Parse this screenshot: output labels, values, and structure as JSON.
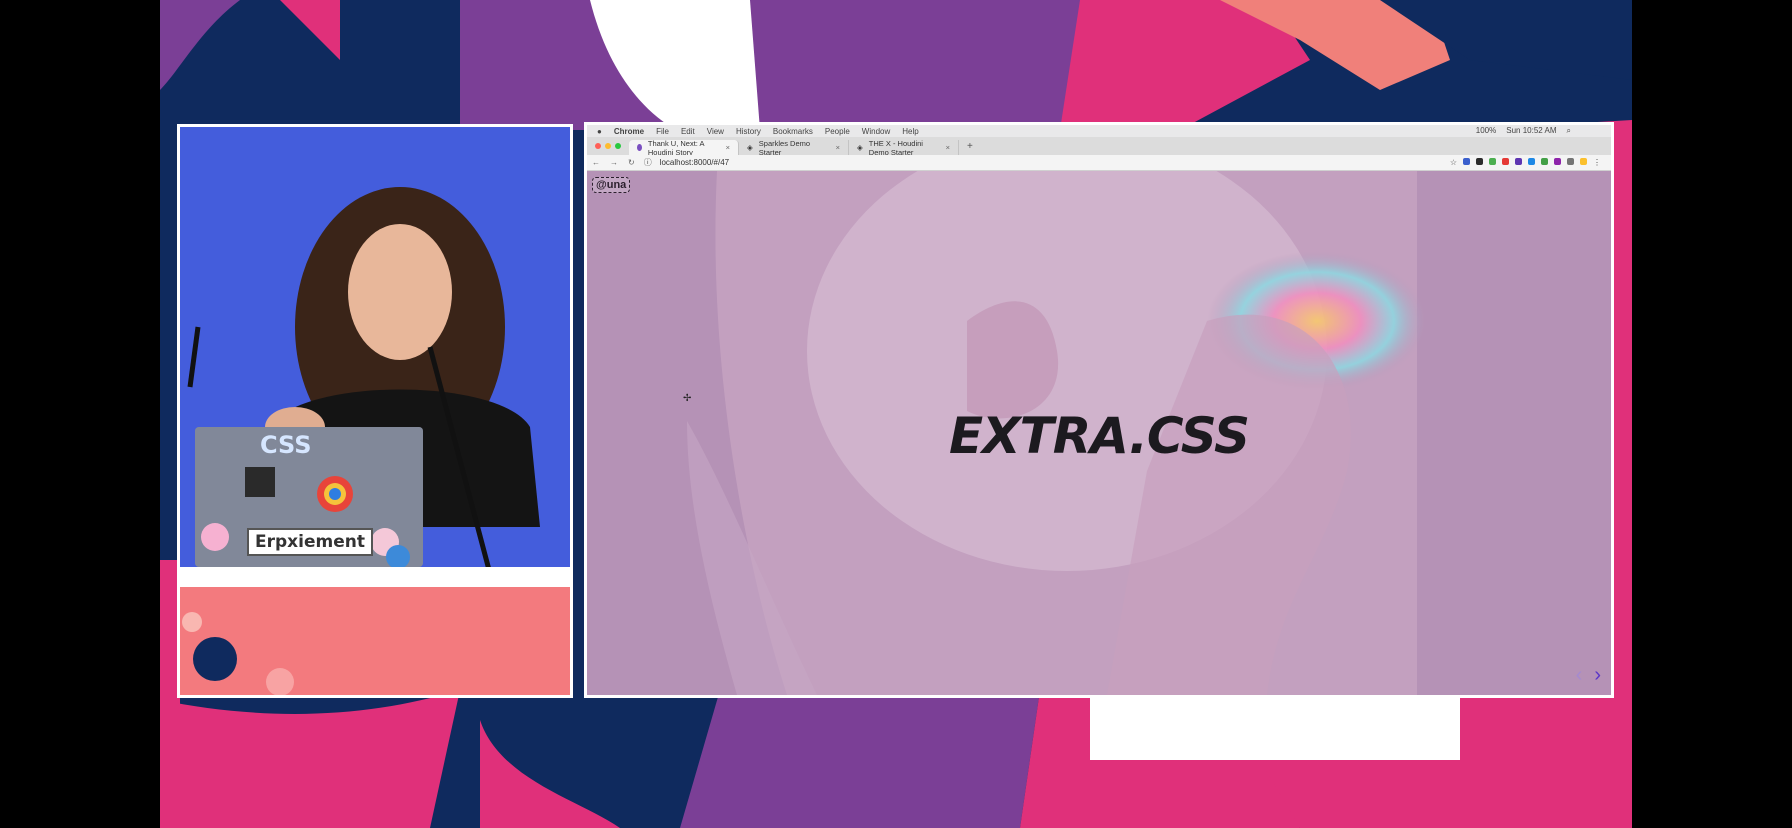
{
  "browser": {
    "menu": [
      "Chrome",
      "File",
      "Edit",
      "View",
      "History",
      "Bookmarks",
      "People",
      "Window",
      "Help"
    ],
    "status_right": [
      "100%",
      "Sun 10:52 AM"
    ],
    "tabs": [
      {
        "label": "Thank U, Next: A Houdini Story",
        "active": true
      },
      {
        "label": "Sparkles Demo Starter",
        "active": false
      },
      {
        "label": "THE X - Houdini Demo Starter",
        "active": false
      }
    ],
    "url": "localhost:8000/#/47"
  },
  "slide": {
    "handle": "@una",
    "headline": "EXTRA.CSS",
    "prev_icon": "‹",
    "next_icon": "›"
  },
  "speaker": {
    "laptop_stickers": [
      "CSS",
      "Erpxiement"
    ]
  },
  "colors": {
    "stage_navy": "#0f2a5e",
    "stage_magenta": "#e0307a",
    "stage_purple": "#7b3f96",
    "stage_salmon": "#f0807a",
    "slide_tint": "#b796b8",
    "accent_purple": "#5a35c8"
  }
}
